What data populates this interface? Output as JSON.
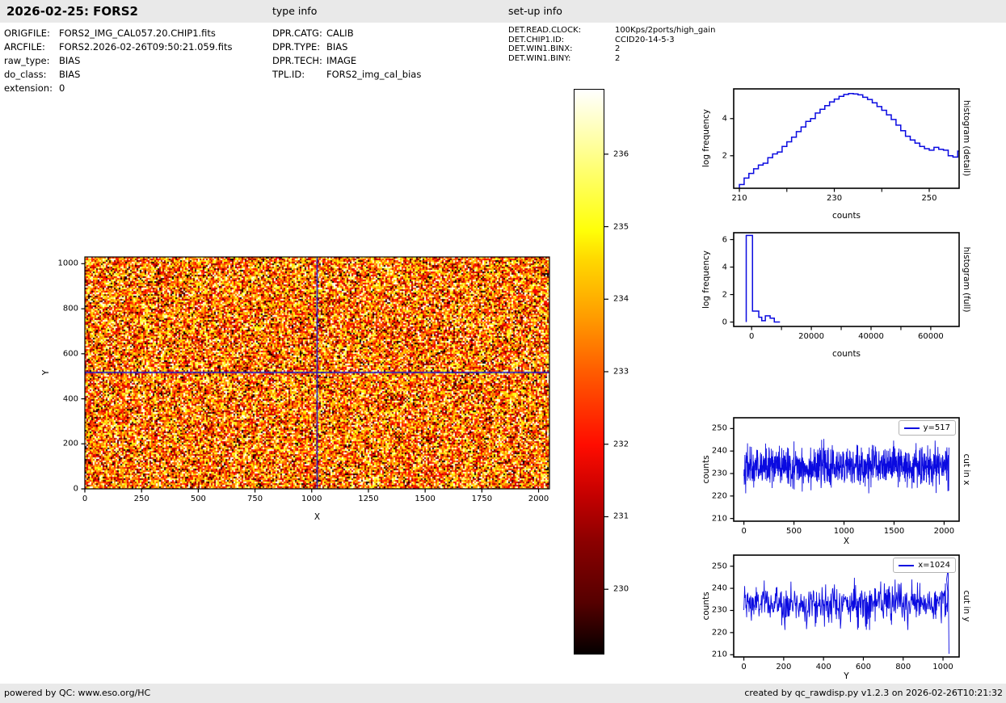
{
  "header": {
    "title": "2026-02-25: FORS2",
    "sections": [
      {
        "label": "type info"
      },
      {
        "label": "set-up info"
      }
    ]
  },
  "file_info": {
    "rows": [
      {
        "label": "ORIGFILE:",
        "value": "FORS2_IMG_CAL057.20.CHIP1.fits"
      },
      {
        "label": "ARCFILE:",
        "value": "FORS2.2026-02-26T09:50:21.059.fits"
      },
      {
        "label": "raw_type:",
        "value": "BIAS"
      },
      {
        "label": "do_class:",
        "value": "BIAS"
      },
      {
        "label": "extension:",
        "value": "0"
      }
    ]
  },
  "type_info": {
    "rows": [
      {
        "label": "DPR.CATG:",
        "value": "CALIB"
      },
      {
        "label": "DPR.TYPE:",
        "value": "BIAS"
      },
      {
        "label": "DPR.TECH:",
        "value": "IMAGE"
      },
      {
        "label": "TPL.ID:",
        "value": "FORS2_img_cal_bias"
      }
    ]
  },
  "setup_info": {
    "rows": [
      {
        "label": "DET.READ.CLOCK:",
        "value": "100Kps/2ports/high_gain"
      },
      {
        "label": "DET.CHIP1.ID:",
        "value": "CCID20-14-5-3"
      },
      {
        "label": "DET.WIN1.BINX:",
        "value": "2"
      },
      {
        "label": "DET.WIN1.BINY:",
        "value": "2"
      }
    ]
  },
  "footer": {
    "left": "powered by QC: www.eso.org/HC",
    "right": "created by qc_rawdisp.py v1.2.3 on 2026-02-26T10:21:32"
  },
  "colors": {
    "line_blue": "#0a0ae0",
    "crosshair_blue": "#1414d2",
    "header_bg": "#e9e9e9",
    "spine": "#000000"
  },
  "chart_data": [
    {
      "id": "raw_image",
      "type": "heatmap",
      "xlabel": "X",
      "ylabel": "Y",
      "xlim": [
        0,
        2048
      ],
      "ylim": [
        0,
        1030
      ],
      "xticks": [
        0,
        250,
        500,
        750,
        1000,
        1250,
        1500,
        1750,
        2000
      ],
      "yticks": [
        0,
        200,
        400,
        600,
        800,
        1000
      ],
      "colormap": "hot",
      "crosshair": {
        "x": 1024,
        "y": 517
      },
      "noise": {
        "mean_counts": 233,
        "sigma_counts": 4.5,
        "seed": 99
      },
      "colorbar": {
        "vmin": 229.1,
        "vmax": 236.9,
        "ticks": [
          230,
          231,
          232,
          233,
          234,
          235,
          236
        ]
      }
    },
    {
      "id": "hist_detail",
      "type": "line",
      "style": "hist-step",
      "xlabel": "counts",
      "ylabel": "log frequency",
      "side_label": "histogram (detail)",
      "xlim": [
        208.8,
        256.3
      ],
      "ylim": [
        0.25,
        5.6
      ],
      "xticks": [
        210,
        230,
        250
      ],
      "xticks_minor": [
        220,
        240
      ],
      "yticks": [
        2,
        4
      ],
      "bin_start": 210,
      "bin_width": 1,
      "values": [
        0.45,
        0.8,
        1.05,
        1.3,
        1.5,
        1.6,
        1.9,
        2.1,
        2.2,
        2.5,
        2.75,
        3.0,
        3.3,
        3.55,
        3.85,
        4.0,
        4.3,
        4.5,
        4.7,
        4.9,
        5.05,
        5.2,
        5.3,
        5.35,
        5.33,
        5.28,
        5.15,
        5.03,
        4.85,
        4.65,
        4.45,
        4.2,
        3.95,
        3.65,
        3.35,
        3.05,
        2.85,
        2.68,
        2.5,
        2.38,
        2.3,
        2.45,
        2.35,
        2.3,
        2.0,
        1.93,
        2.25
      ]
    },
    {
      "id": "hist_full",
      "type": "line",
      "style": "level-step",
      "xlabel": "counts",
      "ylabel": "log frequency",
      "side_label": "histogram (full)",
      "xlim": [
        -6000,
        69500
      ],
      "ylim": [
        -0.32,
        6.5
      ],
      "xticks": [
        0,
        20000,
        40000,
        60000
      ],
      "xticks_minor": [
        10000,
        30000,
        50000
      ],
      "yticks": [
        0,
        2,
        4,
        6
      ],
      "steps": [
        [
          -1800,
          6.3
        ],
        [
          300,
          0.8
        ],
        [
          2400,
          0.35
        ],
        [
          3400,
          0.1
        ],
        [
          4600,
          0.45
        ],
        [
          6200,
          0.28
        ],
        [
          7600,
          0
        ]
      ],
      "steps_end_x": 9500
    },
    {
      "id": "cut_x",
      "type": "line",
      "style": "noise",
      "legend": "y=517",
      "xlabel": "X",
      "ylabel": "counts",
      "side_label": "cut in x",
      "xlim": [
        -102,
        2150
      ],
      "ylim": [
        208.8,
        254.8
      ],
      "xticks": [
        0,
        500,
        1000,
        1500,
        2000
      ],
      "yticks": [
        210,
        220,
        230,
        240,
        250
      ],
      "noise": {
        "n": 1024,
        "x_max": 2048,
        "mean": 233,
        "sigma": 4.3,
        "min": 221.2,
        "max": 246.4,
        "seed": 42
      }
    },
    {
      "id": "cut_y",
      "type": "line",
      "style": "noise",
      "legend": "x=1024",
      "xlabel": "Y",
      "ylabel": "counts",
      "side_label": "cut in y",
      "xlim": [
        -51,
        1081
      ],
      "ylim": [
        209,
        255
      ],
      "xticks": [
        0,
        200,
        400,
        600,
        800,
        1000
      ],
      "yticks": [
        210,
        220,
        230,
        240,
        250
      ],
      "noise": {
        "n": 515,
        "x_max": 1030,
        "mean": 233,
        "sigma": 4.3,
        "min": 221.2,
        "max": 246.4,
        "seed": 1234
      },
      "end_spike": {
        "x": 1024,
        "peak": 249.3,
        "drop_to": 210.4
      }
    }
  ]
}
